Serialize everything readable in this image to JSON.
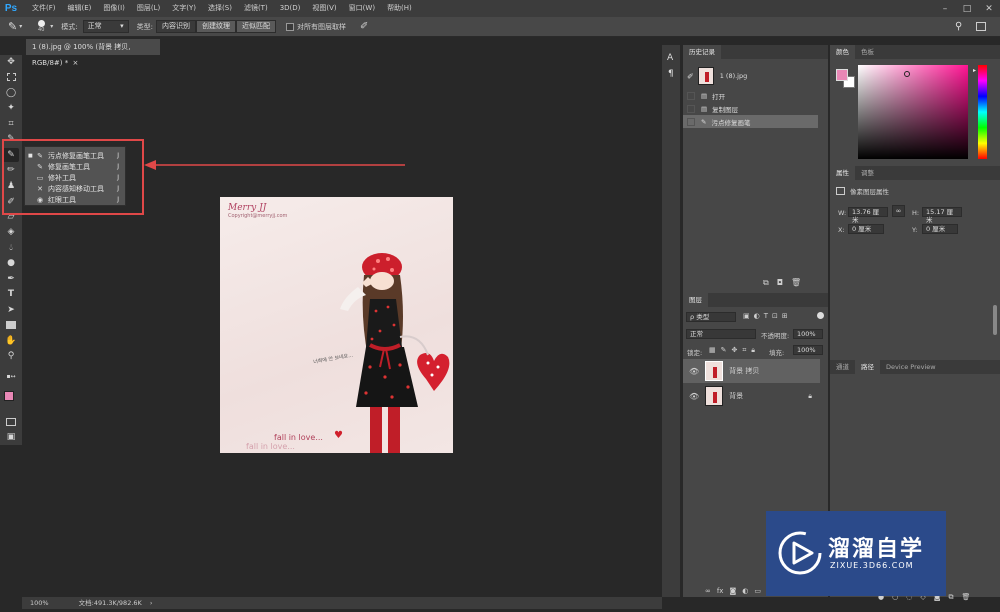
{
  "app": {
    "logo": "Ps"
  },
  "menu": [
    "文件(F)",
    "编辑(E)",
    "图像(I)",
    "图层(L)",
    "文字(Y)",
    "选择(S)",
    "滤镜(T)",
    "3D(D)",
    "视图(V)",
    "窗口(W)",
    "帮助(H)"
  ],
  "window_controls": [
    "–",
    "□",
    "✕"
  ],
  "options": {
    "brush_size": "40",
    "mode_label": "模式:",
    "mode_value": "正常",
    "type_label": "类型:",
    "type_buttons": [
      "内容识别",
      "创建纹理",
      "近似匹配"
    ],
    "sample_all_label": "对所有图层取样"
  },
  "document": {
    "tab_title": "1 (8).jpg @ 100% (背景 拷贝, RGB/8#) *",
    "tab_close": "×"
  },
  "canvas": {
    "brand": "Merry JJ",
    "copyright": "Copyright@merryjj.com",
    "text1": "fall in love...",
    "text2": "fall in love...",
    "korean": "너희에 안 보네요..."
  },
  "flyout": [
    {
      "icon": "spot-healing-brush-icon",
      "glyph": "✎",
      "label": "污点修复画笔工具",
      "shortcut": "J",
      "selected": true
    },
    {
      "icon": "healing-brush-icon",
      "glyph": "✎",
      "label": "修复画笔工具",
      "shortcut": "J",
      "selected": false
    },
    {
      "icon": "patch-icon",
      "glyph": "▭",
      "label": "修补工具",
      "shortcut": "J",
      "selected": false
    },
    {
      "icon": "content-aware-move-icon",
      "glyph": "✕",
      "label": "内容感知移动工具",
      "shortcut": "J",
      "selected": false
    },
    {
      "icon": "red-eye-icon",
      "glyph": "◉",
      "label": "红眼工具",
      "shortcut": "J",
      "selected": false
    }
  ],
  "status": {
    "zoom": "100%",
    "doc_size": "文档:491.3K/982.6K"
  },
  "history": {
    "tabs": [
      "历史记录"
    ],
    "snapshot": "1 (8).jpg",
    "items": [
      "打开",
      "复制图层",
      "污点修复画笔"
    ]
  },
  "color_panel": {
    "tabs": [
      "颜色",
      "色板"
    ],
    "fg_color": "#e887b5",
    "bg_color": "#ffffff",
    "hue_color": "#ff1493"
  },
  "properties": {
    "tabs": [
      "属性",
      "调整"
    ],
    "title": "像素图层属性",
    "w_label": "W:",
    "w_value": "13.76 厘米",
    "h_label": "H:",
    "h_value": "15.17 厘米",
    "x_label": "X:",
    "x_value": "0 厘米",
    "y_label": "Y:",
    "y_value": "0 厘米"
  },
  "layers": {
    "tabs": [
      "图层"
    ],
    "filter_label": "ρ 类型",
    "blend_mode": "正常",
    "opacity_label": "不透明度:",
    "opacity_value": "100%",
    "lock_label": "锁定:",
    "fill_label": "填充:",
    "fill_value": "100%",
    "items": [
      {
        "name": "背景 拷贝",
        "visible": true,
        "locked": false,
        "selected": true
      },
      {
        "name": "背景",
        "visible": true,
        "locked": true,
        "selected": false
      }
    ]
  },
  "bottom_right_tabs": [
    "通道",
    "路径",
    "Device Preview"
  ],
  "watermark": {
    "title": "溜溜自学",
    "url": "ZIXUE.3D66.COM"
  }
}
